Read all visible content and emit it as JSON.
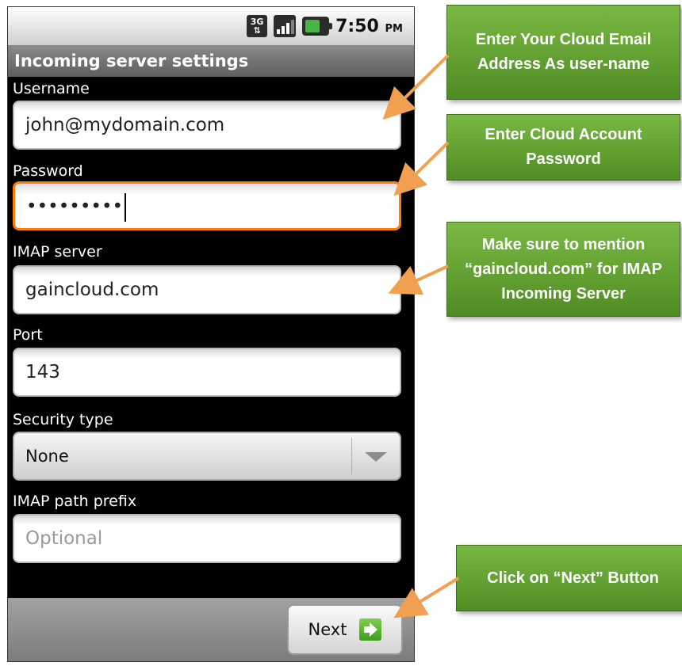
{
  "status_bar": {
    "network_label": "3G",
    "time": "7:50",
    "ampm": "PM"
  },
  "title": "Incoming server settings",
  "fields": {
    "username": {
      "label": "Username",
      "value": "john@mydomain.com"
    },
    "password": {
      "label": "Password",
      "value": "•••••••••"
    },
    "imap_server": {
      "label": "IMAP server",
      "value": "gaincloud.com"
    },
    "port": {
      "label": "Port",
      "value": "143"
    },
    "security_type": {
      "label": "Security type",
      "value": "None"
    },
    "imap_path_prefix": {
      "label": "IMAP path prefix",
      "placeholder": "Optional"
    }
  },
  "next_button": {
    "label": "Next"
  },
  "callouts": {
    "username": "Enter Your Cloud Email Address As user-name",
    "password": "Enter Cloud Account Password",
    "imap_server": "Make sure to mention “gaincloud.com” for IMAP Incoming Server",
    "next": "Click on “Next” Button"
  },
  "colors": {
    "callout_green": "#6aa737",
    "arrow_orange": "#f0a050",
    "focus_orange": "#ff7d00"
  }
}
